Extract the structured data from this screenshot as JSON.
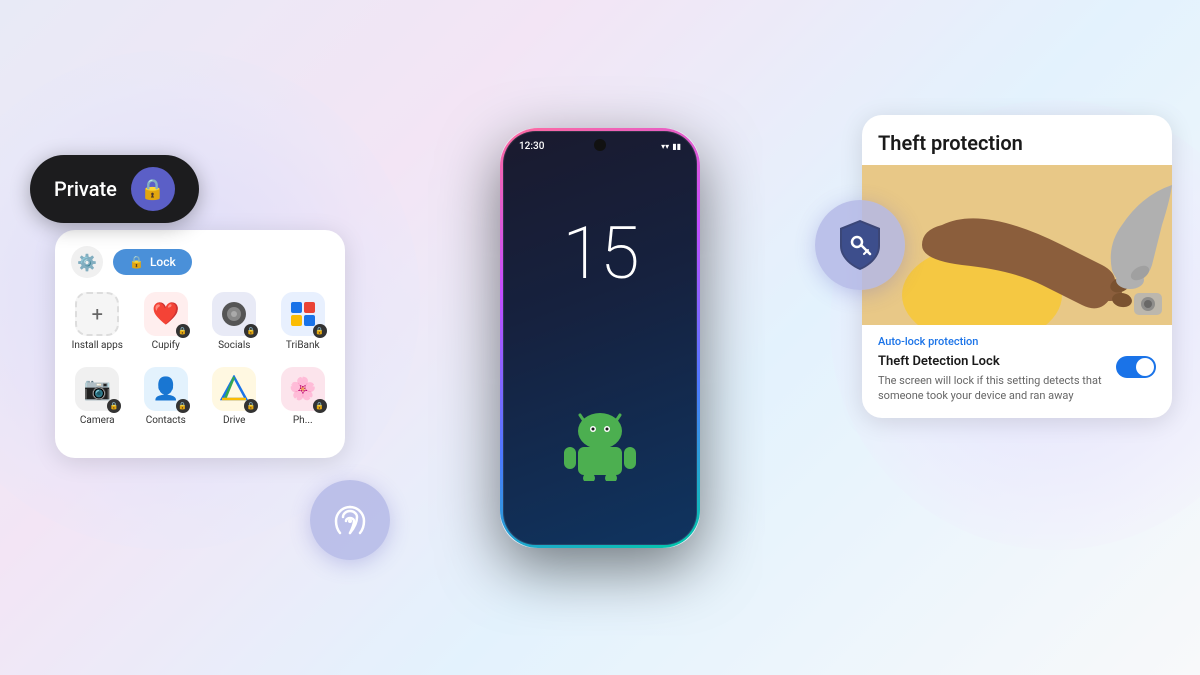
{
  "background": {
    "gradient": "linear-gradient(135deg, #e8eaf6, #f3e5f5, #e3f2fd, #f8f9fa)"
  },
  "private_toggle": {
    "label": "Private",
    "lock_icon": "🔒"
  },
  "app_grid": {
    "lock_button_label": "Lock",
    "lock_icon": "🔒",
    "apps_row1": [
      {
        "name": "Install apps",
        "icon": "➕",
        "bg": "#f0f0f0",
        "has_lock": false
      },
      {
        "name": "Cupify",
        "icon": "❤️",
        "bg": "#ffeeee",
        "has_lock": true
      },
      {
        "name": "Socials",
        "icon": "◎",
        "bg": "#f0f0f0",
        "has_lock": true
      },
      {
        "name": "TriBank",
        "icon": "🏦",
        "bg": "#e8f0fe",
        "has_lock": true
      }
    ],
    "apps_row2": [
      {
        "name": "Camera",
        "icon": "📷",
        "bg": "#f0f0f0",
        "has_lock": true
      },
      {
        "name": "Contacts",
        "icon": "👤",
        "bg": "#e8f4fd",
        "has_lock": true
      },
      {
        "name": "Drive",
        "icon": "△",
        "bg": "#fff8e1",
        "has_lock": true
      },
      {
        "name": "Ph...",
        "icon": "🌸",
        "bg": "#fce4ec",
        "has_lock": true
      }
    ]
  },
  "phone": {
    "time": "12:30",
    "clock_number": "15"
  },
  "fingerprint": {
    "icon": "◎"
  },
  "shield": {
    "icon": "🛡️"
  },
  "theft_card": {
    "title": "Theft protection",
    "auto_lock_label": "Auto-lock protection",
    "detection_title": "Theft Detection Lock",
    "detection_desc": "The screen will lock if this setting detects that someone took your device and ran away",
    "toggle_on": true
  }
}
